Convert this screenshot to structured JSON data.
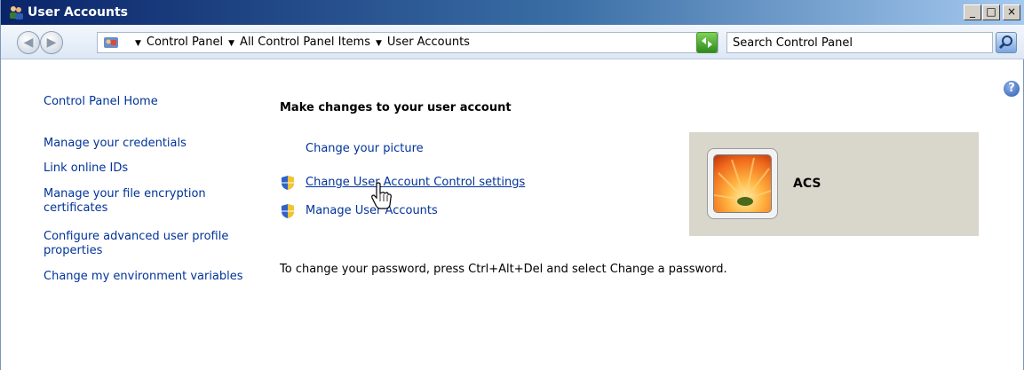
{
  "window": {
    "title": "User Accounts",
    "controls": {
      "minimize": "_",
      "maximize": "□",
      "close": "×"
    }
  },
  "navigation": {
    "back_icon": "back-arrow-icon",
    "forward_icon": "forward-arrow-icon",
    "breadcrumbs": [
      "Control Panel",
      "All Control Panel Items",
      "User Accounts"
    ],
    "search_placeholder": "Search Control Panel"
  },
  "sidebar": {
    "items": [
      {
        "label": "Control Panel Home"
      },
      {
        "label": "Manage your credentials"
      },
      {
        "label": "Link online IDs"
      },
      {
        "label": "Manage your file encryption certificates"
      },
      {
        "label": "Configure advanced user profile properties"
      },
      {
        "label": "Change my environment variables"
      }
    ]
  },
  "main": {
    "heading": "Make changes to your user account",
    "tasks": [
      {
        "label": "Change your picture",
        "icon": ""
      },
      {
        "label": "Change User Account Control settings",
        "icon": "uac-shield-icon"
      },
      {
        "label": "Manage User Accounts",
        "icon": "uac-shield-icon"
      }
    ],
    "password_note": "To change your password, press Ctrl+Alt+Del and select Change a password."
  },
  "account": {
    "name": "ACS",
    "picture_icon": "flower-picture"
  },
  "colors": {
    "link": "#003399",
    "title_bar_start": "#0a246a",
    "title_bar_end": "#a6caf0",
    "account_panel": "#d9d6cc"
  }
}
